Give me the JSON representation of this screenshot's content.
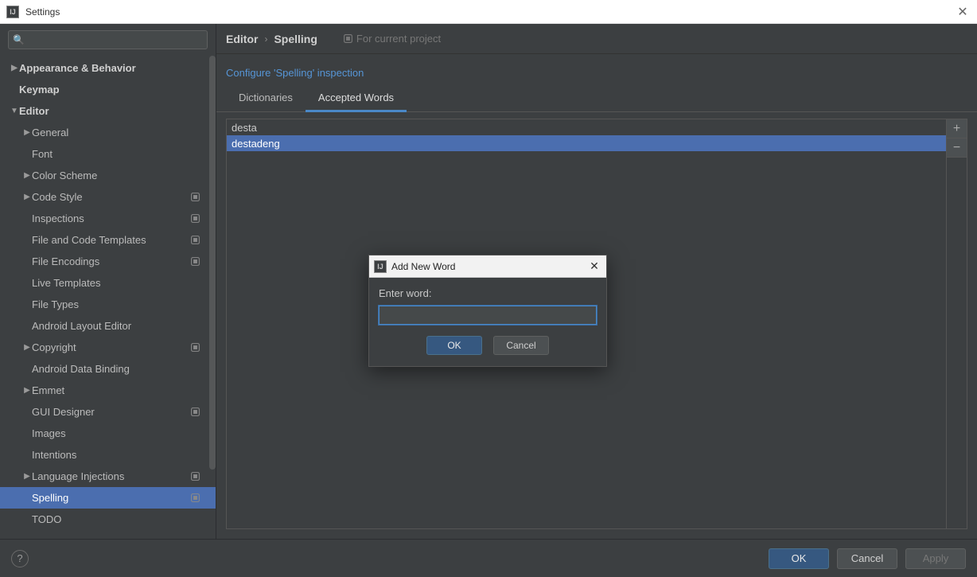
{
  "window": {
    "title": "Settings",
    "close_glyph": "✕"
  },
  "search": {
    "placeholder": ""
  },
  "sidebar": {
    "items": [
      {
        "label": "Appearance & Behavior",
        "level": 0,
        "bold": true,
        "arrow": "▶",
        "proj": false
      },
      {
        "label": "Keymap",
        "level": 0,
        "bold": true,
        "arrow": "",
        "proj": false
      },
      {
        "label": "Editor",
        "level": 0,
        "bold": true,
        "arrow": "▼",
        "proj": false
      },
      {
        "label": "General",
        "level": 1,
        "bold": false,
        "arrow": "▶",
        "proj": false
      },
      {
        "label": "Font",
        "level": 1,
        "bold": false,
        "arrow": "",
        "proj": false
      },
      {
        "label": "Color Scheme",
        "level": 1,
        "bold": false,
        "arrow": "▶",
        "proj": false
      },
      {
        "label": "Code Style",
        "level": 1,
        "bold": false,
        "arrow": "▶",
        "proj": true
      },
      {
        "label": "Inspections",
        "level": 1,
        "bold": false,
        "arrow": "",
        "proj": true
      },
      {
        "label": "File and Code Templates",
        "level": 1,
        "bold": false,
        "arrow": "",
        "proj": true
      },
      {
        "label": "File Encodings",
        "level": 1,
        "bold": false,
        "arrow": "",
        "proj": true
      },
      {
        "label": "Live Templates",
        "level": 1,
        "bold": false,
        "arrow": "",
        "proj": false
      },
      {
        "label": "File Types",
        "level": 1,
        "bold": false,
        "arrow": "",
        "proj": false
      },
      {
        "label": "Android Layout Editor",
        "level": 1,
        "bold": false,
        "arrow": "",
        "proj": false
      },
      {
        "label": "Copyright",
        "level": 1,
        "bold": false,
        "arrow": "▶",
        "proj": true
      },
      {
        "label": "Android Data Binding",
        "level": 1,
        "bold": false,
        "arrow": "",
        "proj": false
      },
      {
        "label": "Emmet",
        "level": 1,
        "bold": false,
        "arrow": "▶",
        "proj": false
      },
      {
        "label": "GUI Designer",
        "level": 1,
        "bold": false,
        "arrow": "",
        "proj": true
      },
      {
        "label": "Images",
        "level": 1,
        "bold": false,
        "arrow": "",
        "proj": false
      },
      {
        "label": "Intentions",
        "level": 1,
        "bold": false,
        "arrow": "",
        "proj": false
      },
      {
        "label": "Language Injections",
        "level": 1,
        "bold": false,
        "arrow": "▶",
        "proj": true
      },
      {
        "label": "Spelling",
        "level": 1,
        "bold": false,
        "arrow": "",
        "proj": true,
        "selected": true
      },
      {
        "label": "TODO",
        "level": 1,
        "bold": false,
        "arrow": "",
        "proj": false
      }
    ]
  },
  "breadcrumb": {
    "root": "Editor",
    "sep": "›",
    "leaf": "Spelling",
    "project_hint": "For current project"
  },
  "config_link": "Configure 'Spelling' inspection",
  "tabs": {
    "items": [
      {
        "label": "Dictionaries",
        "active": false
      },
      {
        "label": "Accepted Words",
        "active": true
      }
    ]
  },
  "words": {
    "items": [
      {
        "text": "desta",
        "selected": false
      },
      {
        "text": "destadeng",
        "selected": true
      }
    ]
  },
  "list_actions": {
    "add": "+",
    "remove": "−"
  },
  "footer": {
    "ok": "OK",
    "cancel": "Cancel",
    "apply": "Apply",
    "help": "?"
  },
  "dialog": {
    "title": "Add New Word",
    "label": "Enter word:",
    "value": "",
    "ok": "OK",
    "cancel": "Cancel",
    "close_glyph": "✕"
  }
}
